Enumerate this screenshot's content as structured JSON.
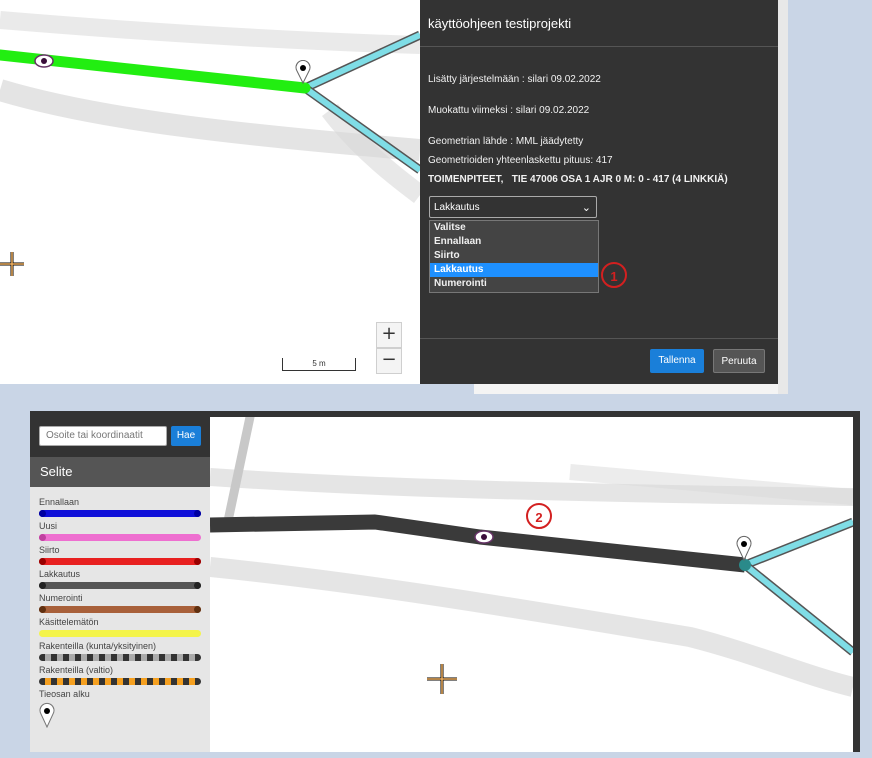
{
  "top_panel": {
    "title": "käyttöohjeen testiprojekti",
    "added": "Lisätty järjestelmään : silari 09.02.2022",
    "modified": "Muokattu viimeksi : silari 09.02.2022",
    "geometry_source": "Geometrian lähde : MML jäädytetty",
    "total_length": "Geometrioiden yhteenlaskettu pituus: 417",
    "actions_line": "TOIMENPITEET,   TIE 47006 OSA 1 AJR 0 M: 0 - 417 (4 LINKKIÄ)",
    "selected_action": "Lakkautus",
    "options": [
      "Valitse",
      "Ennallaan",
      "Siirto",
      "Lakkautus",
      "Numerointi"
    ],
    "save_label": "Tallenna",
    "cancel_label": "Peruuta"
  },
  "top_map": {
    "zoom_in": "+",
    "zoom_out": "−",
    "scale_label": "5 m"
  },
  "callouts": {
    "one": "1",
    "two": "2"
  },
  "bottom": {
    "search_placeholder": "Osoite tai koordinaatit",
    "search_button": "Hae",
    "legend_title": "Selite",
    "legend": [
      {
        "label": "Ennallaan",
        "color": "#1010d8"
      },
      {
        "label": "Uusi",
        "color": "#ee6fd0"
      },
      {
        "label": "Siirto",
        "color": "#e82020"
      },
      {
        "label": "Lakkautus",
        "color": "#555555"
      },
      {
        "label": "Numerointi",
        "color": "#a8603a"
      },
      {
        "label": "Käsittelemätön",
        "color": "#f4f44a"
      },
      {
        "label": "Rakenteilla (kunta/yksityinen)",
        "color": "#888888"
      },
      {
        "label": "Rakenteilla (valtio)",
        "color": "#f5a020"
      },
      {
        "label": "Tieosan alku",
        "color": "#000000"
      }
    ]
  },
  "icons": [
    "eye-icon",
    "map-pin-icon",
    "crosshair-icon",
    "chevron-down-icon"
  ],
  "colors": {
    "panel_bg": "#333333",
    "accent_blue": "#1a7fd9",
    "road_green": "#22ee11",
    "road_cyan": "#7fdde6",
    "road_dark": "#3a3a3a",
    "callout_red": "#d32020"
  }
}
